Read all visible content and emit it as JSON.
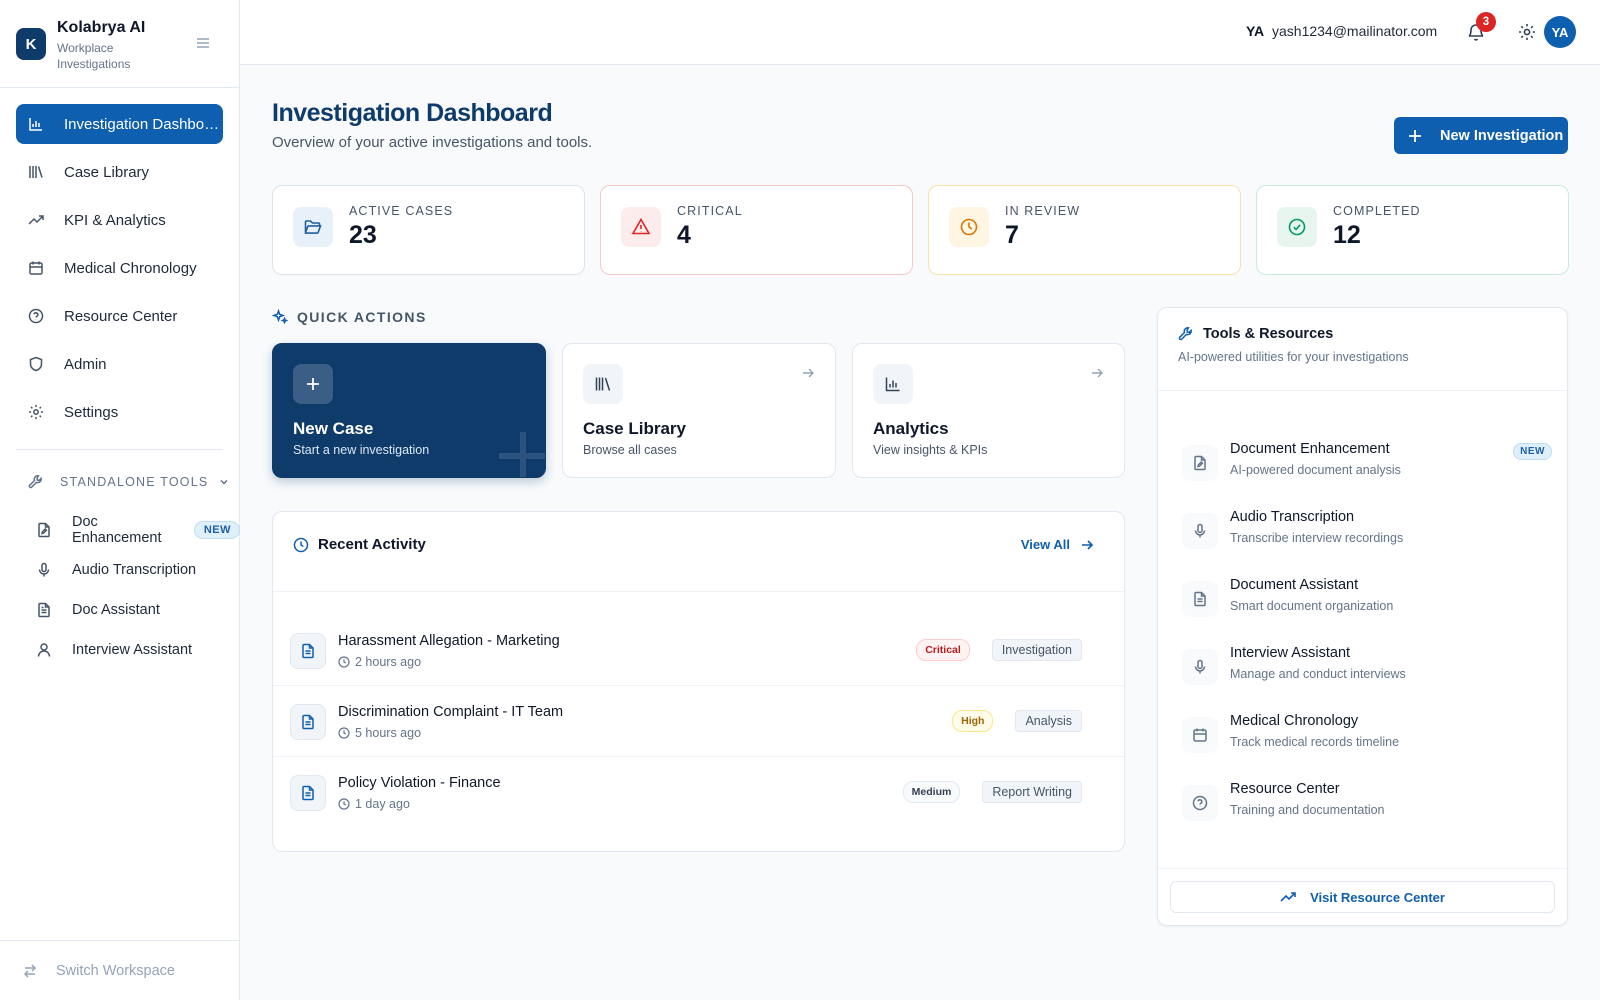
{
  "brand": {
    "logo_letter": "K",
    "name": "Kolabrya AI",
    "subtitle": "Workplace Investigations"
  },
  "sidebar": {
    "items": [
      {
        "label": "Investigation Dashboard",
        "icon": "bar-chart-icon",
        "active": true
      },
      {
        "label": "Case Library",
        "icon": "library-icon"
      },
      {
        "label": "KPI & Analytics",
        "icon": "trending-up-icon"
      },
      {
        "label": "Medical Chronology",
        "icon": "calendar-icon"
      },
      {
        "label": "Resource Center",
        "icon": "help-circle-icon"
      },
      {
        "label": "Admin",
        "icon": "shield-icon"
      },
      {
        "label": "Settings",
        "icon": "gear-icon"
      }
    ],
    "tools_heading": "STANDALONE TOOLS",
    "tools": [
      {
        "label": "Doc Enhancement",
        "badge": "NEW",
        "icon": "file-edit-icon"
      },
      {
        "label": "Audio Transcription",
        "icon": "microphone-icon"
      },
      {
        "label": "Doc Assistant",
        "icon": "file-text-icon"
      },
      {
        "label": "Interview Assistant",
        "icon": "user-icon"
      }
    ],
    "switch_workspace": "Switch Workspace"
  },
  "topbar": {
    "user_initials": "YA",
    "user_email": "yash1234@mailinator.com",
    "notification_count": "3",
    "avatar_initials": "YA"
  },
  "header": {
    "title": "Investigation Dashboard",
    "subtitle": "Overview of your active investigations and tools.",
    "new_button": "New Investigation"
  },
  "stats": [
    {
      "label": "ACTIVE CASES",
      "value": "23",
      "icon": "folder-open-icon",
      "color": "#1e5fa3",
      "bg": "#e8f0f9",
      "border": "#dbe3ec"
    },
    {
      "label": "CRITICAL",
      "value": "4",
      "icon": "alert-triangle-icon",
      "color": "#dc2626",
      "bg": "#fdecec",
      "border": "#f6c9c9"
    },
    {
      "label": "IN REVIEW",
      "value": "7",
      "icon": "clock-icon",
      "color": "#d97706",
      "bg": "#fef5e3",
      "border": "#f8e2a9"
    },
    {
      "label": "COMPLETED",
      "value": "12",
      "icon": "check-circle-icon",
      "color": "#059669",
      "bg": "#e6f6ef",
      "border": "#c6ecdc"
    }
  ],
  "quick_actions": {
    "heading": "QUICK ACTIONS",
    "cards": [
      {
        "title": "New Case",
        "subtitle": "Start a new investigation",
        "icon": "plus-icon"
      },
      {
        "title": "Case Library",
        "subtitle": "Browse all cases",
        "icon": "library-icon"
      },
      {
        "title": "Analytics",
        "subtitle": "View insights & KPIs",
        "icon": "bar-chart-icon"
      }
    ]
  },
  "activity": {
    "title": "Recent Activity",
    "view_all": "View All",
    "rows": [
      {
        "title": "Harassment Allegation - Marketing",
        "time": "2 hours ago",
        "priority": "Critical",
        "stage": "Investigation"
      },
      {
        "title": "Discrimination Complaint - IT Team",
        "time": "5 hours ago",
        "priority": "High",
        "stage": "Analysis"
      },
      {
        "title": "Policy Violation - Finance",
        "time": "1 day ago",
        "priority": "Medium",
        "stage": "Report Writing"
      }
    ]
  },
  "tools_panel": {
    "title": "Tools & Resources",
    "subtitle": "AI-powered utilities for your investigations",
    "items": [
      {
        "title": "Document Enhancement",
        "subtitle": "AI-powered document analysis",
        "badge": "NEW",
        "icon": "file-edit-icon"
      },
      {
        "title": "Audio Transcription",
        "subtitle": "Transcribe interview recordings",
        "icon": "microphone-icon"
      },
      {
        "title": "Document Assistant",
        "subtitle": "Smart document organization",
        "icon": "file-text-icon"
      },
      {
        "title": "Interview Assistant",
        "subtitle": "Manage and conduct interviews",
        "icon": "microphone-icon"
      },
      {
        "title": "Medical Chronology",
        "subtitle": "Track medical records timeline",
        "icon": "calendar-icon"
      },
      {
        "title": "Resource Center",
        "subtitle": "Training and documentation",
        "icon": "help-circle-icon"
      }
    ],
    "visit_button": "Visit Resource Center"
  }
}
